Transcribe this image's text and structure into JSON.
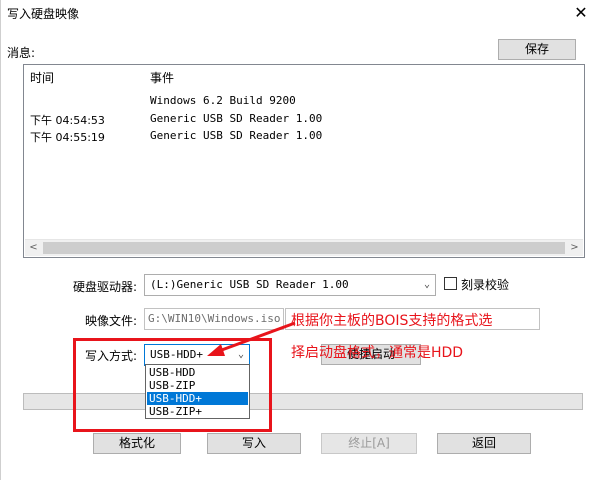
{
  "window": {
    "title": "写入硬盘映像",
    "close_glyph": "✕"
  },
  "messages": {
    "label": "消息:",
    "save_button": "保存",
    "columns": [
      "时间",
      "事件"
    ],
    "rows": [
      {
        "time": "",
        "event": "Windows 6.2 Build 9200"
      },
      {
        "time": "下午 04:54:53",
        "event": "Generic USB SD Reader   1.00"
      },
      {
        "time": "下午 04:55:19",
        "event": "Generic USB SD Reader   1.00"
      }
    ],
    "scroll_left": "<",
    "scroll_right": ">"
  },
  "drive": {
    "label": "硬盘驱动器:",
    "value": "(L:)Generic USB SD Reader   1.00",
    "verify_label": "刻录校验"
  },
  "image": {
    "label": "映像文件:",
    "value": "G:\\WIN10\\Windows.iso"
  },
  "write_mode": {
    "label": "写入方式:",
    "selected": "USB-HDD+",
    "options": [
      "USB-HDD",
      "USB-ZIP",
      "USB-HDD+",
      "USB-ZIP+"
    ]
  },
  "hidden_button": {
    "label": "便捷启动"
  },
  "buttons": {
    "format": "格式化",
    "write": "写入",
    "stop": "终止[A]",
    "back": "返回"
  },
  "annotation": {
    "line1": "根据你主板的BOIS支持的格式选",
    "line2": "择启动盘格式，通常是HDD",
    "color": "#e8141b"
  }
}
